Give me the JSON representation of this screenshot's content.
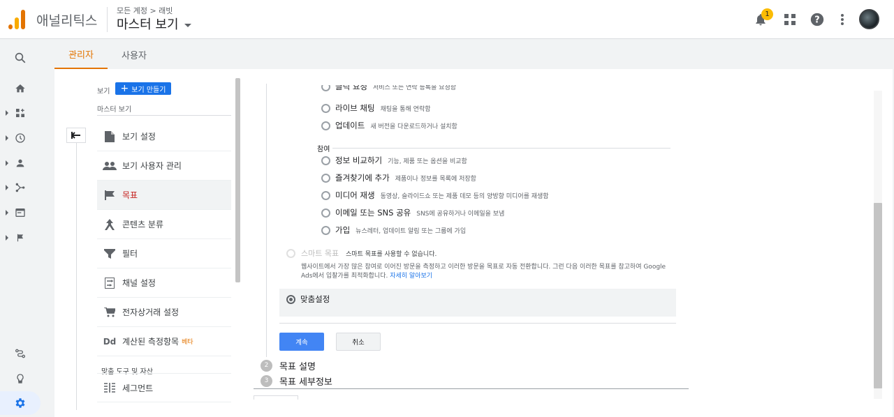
{
  "header": {
    "app_name": "애널리틱스",
    "breadcrumb": "모든 계정 > 래빗",
    "view_title": "마스터 보기",
    "notification_count": "1"
  },
  "tabs": [
    {
      "label": "관리자"
    },
    {
      "label": "사용자"
    }
  ],
  "nav": {
    "view_label": "보기",
    "create_view_label": "보기 만들기",
    "current_view": "마스터 보기",
    "items": [
      {
        "label": "보기 설정"
      },
      {
        "label": "보기 사용자 관리"
      },
      {
        "label": "목표"
      },
      {
        "label": "콘텐츠 분류"
      },
      {
        "label": "필터"
      },
      {
        "label": "채널 설정"
      },
      {
        "label": "전자상거래 설정"
      },
      {
        "label": "계산된 측정항목",
        "badge": "베타"
      }
    ],
    "section_title": "맞춤 도구 및 자산",
    "section_items": [
      {
        "label": "세그먼트"
      }
    ]
  },
  "goals": {
    "partial_top": {
      "name": "클릭 요청",
      "desc": "서비스 또는 연락 등록을 요청함"
    },
    "group1": [
      {
        "name": "라이브 채팅",
        "desc": "채팅을 통해 연락함"
      },
      {
        "name": "업데이트",
        "desc": "새 버전을 다운로드하거나 설치함"
      }
    ],
    "group2_label": "참여",
    "group2": [
      {
        "name": "정보 비교하기",
        "desc": "기능, 제품 또는 옵션을 비교함"
      },
      {
        "name": "즐겨찾기에 추가",
        "desc": "제품이나 정보를 목록에 저장함"
      },
      {
        "name": "미디어 재생",
        "desc": "동영상, 슬라이드쇼 또는 제품 데모 등의 양방향 미디어를 재생함"
      },
      {
        "name": "이메일 또는 SNS 공유",
        "desc": "SNS에 공유하거나 이메일을 보냄"
      },
      {
        "name": "가입",
        "desc": "뉴스레터, 업데이트 알림 또는 그룹에 가입"
      }
    ],
    "smart": {
      "name": "스마트 목표",
      "note": "스마트 목표를 사용할 수 없습니다.",
      "para": "웹사이트에서 가장 많은 참여로 이어진 방문을 측정하고 이러한 방문을 목표로 자동 전환합니다. 그런 다음 이러한 목표를 참고하여 Google Ads에서 입찰가를 최적화합니다.",
      "link": "자세히 알아보기"
    },
    "custom": {
      "name": "맞춤설정"
    },
    "continue_label": "계속",
    "cancel_label": "취소",
    "steps": [
      {
        "num": "2",
        "label": "목표 설명"
      },
      {
        "num": "3",
        "label": "목표 세부정보"
      }
    ]
  }
}
